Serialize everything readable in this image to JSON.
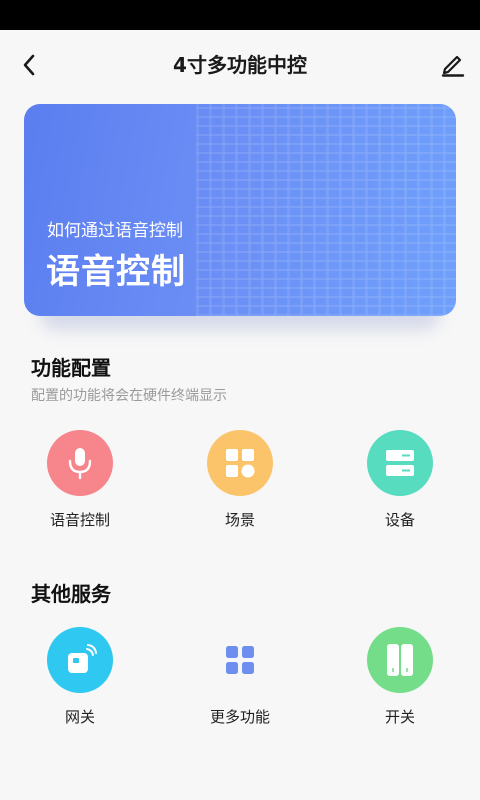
{
  "header": {
    "title": "4寸多功能中控",
    "back_icon": "chevron-left-icon",
    "edit_icon": "pencil-icon"
  },
  "banner": {
    "subtitle": "如何通过语音控制",
    "title": "语音控制"
  },
  "function_config": {
    "title": "功能配置",
    "description": "配置的功能将会在硬件终端显示",
    "items": [
      {
        "label": "语音控制",
        "icon": "microphone-icon",
        "color": "#f7858c"
      },
      {
        "label": "场景",
        "icon": "scene-grid-icon",
        "color": "#fbc46a"
      },
      {
        "label": "设备",
        "icon": "device-icon",
        "color": "#58dcc0"
      }
    ]
  },
  "other_services": {
    "title": "其他服务",
    "items": [
      {
        "label": "网关",
        "icon": "gateway-icon",
        "color": "#2ec8f0"
      },
      {
        "label": "更多功能",
        "icon": "more-grid-icon",
        "color": "#6f8ff0"
      },
      {
        "label": "开关",
        "icon": "switch-icon",
        "color": "#74dd8a"
      }
    ]
  }
}
